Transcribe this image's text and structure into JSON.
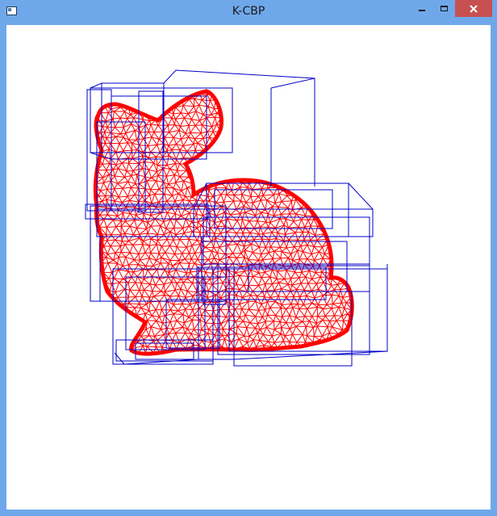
{
  "window": {
    "title": "K-CBP"
  },
  "controls": {
    "minimize": "minimize-icon",
    "maximize": "maximize-icon",
    "close": "close-icon"
  },
  "colors": {
    "frame": "#6fa8ea",
    "mesh": "#ff0000",
    "boxes": "#0000c8",
    "close": "#c75050",
    "canvas": "#ffffff"
  },
  "scene": {
    "object": "bunny-mesh",
    "overlay": "bounding-boxes"
  }
}
